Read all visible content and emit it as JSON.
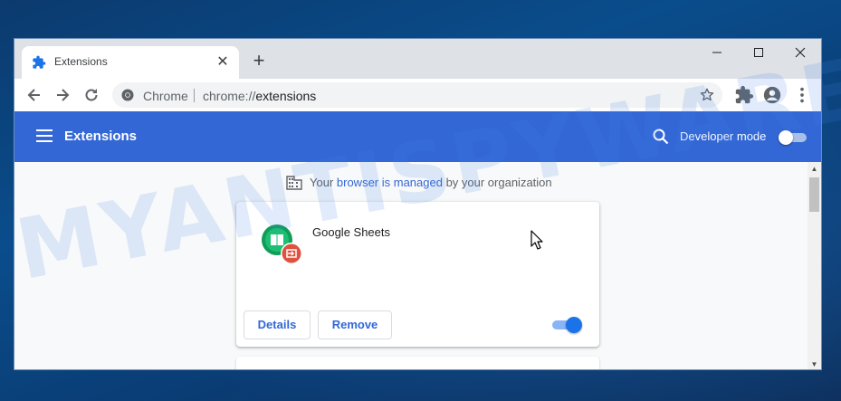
{
  "browser": {
    "tab": {
      "title": "Extensions",
      "icon": "puzzle-icon"
    },
    "new_tab_label": "+",
    "window_controls": [
      "minimize-icon",
      "maximize-icon",
      "close-icon"
    ]
  },
  "toolbar": {
    "site_label": "Chrome",
    "url_scheme": "chrome://",
    "url_path": "extensions"
  },
  "header": {
    "title": "Extensions",
    "developer_mode_label": "Developer mode",
    "developer_mode_on": false
  },
  "managed_notice": {
    "prefix": "Your ",
    "link": "browser is managed",
    "suffix": " by your organization"
  },
  "extensions": [
    {
      "name": "Google Sheets",
      "details_label": "Details",
      "remove_label": "Remove",
      "enabled": true
    }
  ],
  "watermark": "MYANTISPYWARE.COM",
  "colors": {
    "header_blue": "#3367d6",
    "toggle_on": "#1a73e8",
    "link": "#3367d6"
  }
}
